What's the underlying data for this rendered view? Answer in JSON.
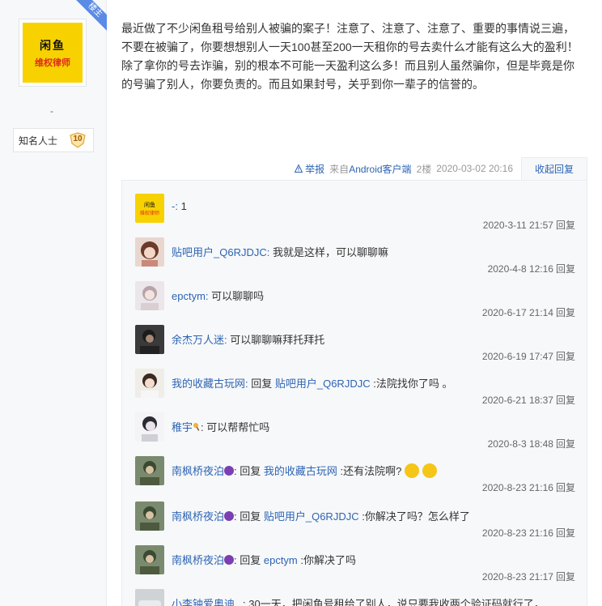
{
  "author": {
    "badge": "楼主",
    "avatar_line1": "闲鱼",
    "avatar_line2": "维权律师",
    "dash": "-",
    "level_title": "知名人士",
    "level_num": "10"
  },
  "post": {
    "content": "最近做了不少闲鱼租号给别人被骗的案子！注意了、注意了、注意了、重要的事情说三遍，不要在被骗了，你要想想别人一天100甚至200一天租你的号去卖什么才能有这么大的盈利！除了拿你的号去诈骗，别的根本不可能一天盈利这么多！而且别人虽然骗你，但是毕竟是你的号骗了别人，你要负责的。而且如果封号，关乎到你一辈子的信誉的。"
  },
  "tail": {
    "report": "举报",
    "source": "来自Android客户端",
    "floor": "2楼",
    "datetime": "2020-03-02 20:16",
    "collapse": "收起回复"
  },
  "comments": [
    {
      "pre": "",
      "user": "-:",
      "mid": "",
      "target": "",
      "text": " 1",
      "time": "2020-3-11 21:57",
      "reply": "回复"
    },
    {
      "pre": "",
      "user": "贴吧用户_Q6RJDJC:",
      "mid": "",
      "target": "",
      "text": " 我就是这样，可以聊聊嘛",
      "time": "2020-4-8 12:16",
      "reply": "回复"
    },
    {
      "pre": "",
      "user": "epctym:",
      "mid": "",
      "target": "",
      "text": " 可以聊聊吗",
      "time": "2020-6-17 21:14",
      "reply": "回复"
    },
    {
      "pre": "",
      "user": "余杰万人迷:",
      "mid": "",
      "target": "",
      "text": " 可以聊聊嘛拜托拜托",
      "time": "2020-6-19 17:47",
      "reply": "回复"
    },
    {
      "pre": "",
      "user": "我的收藏古玩网:",
      "mid": " 回复 ",
      "target": "贴吧用户_Q6RJDJC",
      "text": " :法院找你了吗 。",
      "time": "2020-6-21 18:37",
      "reply": "回复"
    },
    {
      "pre": "",
      "user": "稚宇",
      "mid": "",
      "target": "",
      "text": ": 可以帮帮忙吗",
      "time": "2020-8-3 18:48",
      "reply": "回复"
    },
    {
      "pre": "",
      "user": "南枫桥夜泊",
      "mid": ": 回复 ",
      "target": "我的收藏古玩网",
      "text": " :还有法院啊?",
      "time": "2020-8-23 21:16",
      "reply": "回复"
    },
    {
      "pre": "",
      "user": "南枫桥夜泊",
      "mid": ": 回复 ",
      "target": "贴吧用户_Q6RJDJC",
      "text": " :你解决了吗？怎么样了",
      "time": "2020-8-23 21:16",
      "reply": "回复"
    },
    {
      "pre": "",
      "user": "南枫桥夜泊",
      "mid": ": 回复 ",
      "target": "epctym",
      "text": " :你解决了吗",
      "time": "2020-8-23 21:17",
      "reply": "回复"
    },
    {
      "pre": "",
      "user": "小李钟爱奥迪",
      "mid": "",
      "target": "",
      "text": ": 30一天，把闲鱼号租给了别人，说只要我收两个验证码就行了，",
      "time": "",
      "reply": ""
    }
  ],
  "colors": {
    "link": "#2d64b3",
    "badge_bg": "#5a8be6",
    "avatar_bg": "#f7d200",
    "panel_bg": "#f7f8fa"
  }
}
